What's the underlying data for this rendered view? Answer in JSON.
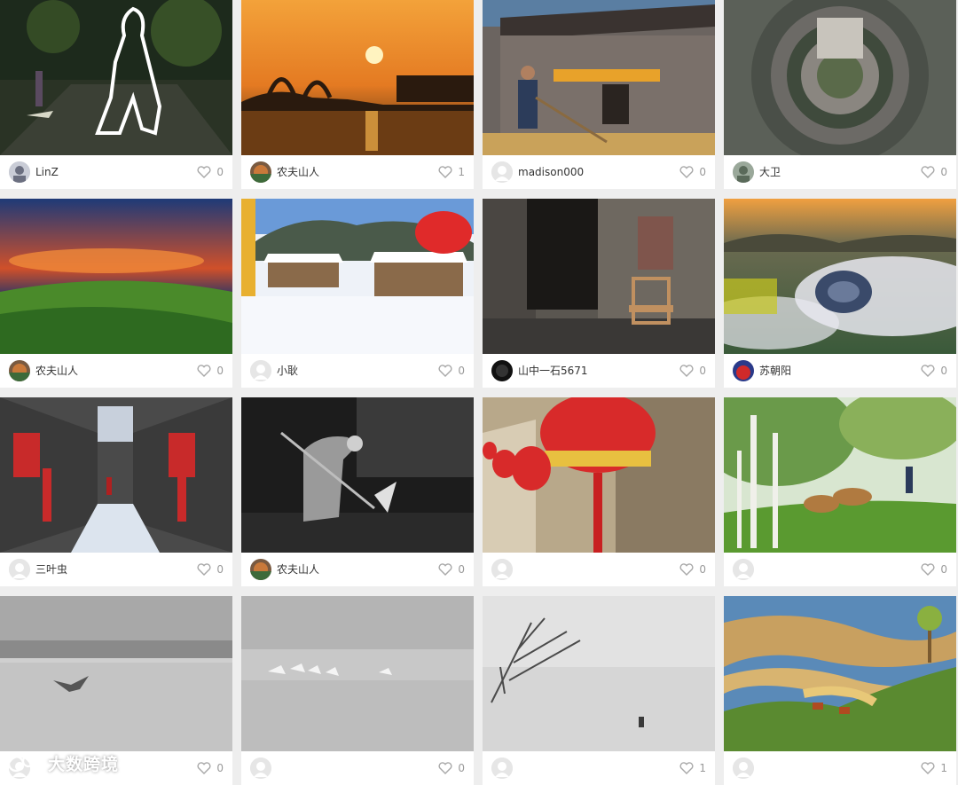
{
  "cards": [
    {
      "user": "LinZ",
      "likes": "0",
      "avatar": "photo"
    },
    {
      "user": "农夫山人",
      "likes": "1",
      "avatar": "photo"
    },
    {
      "user": "madison000",
      "likes": "0",
      "avatar": "empty"
    },
    {
      "user": "大卫",
      "likes": "0",
      "avatar": "photo"
    },
    {
      "user": "农夫山人",
      "likes": "0",
      "avatar": "photo"
    },
    {
      "user": "小耿",
      "likes": "0",
      "avatar": "empty"
    },
    {
      "user": "山中一石5671",
      "likes": "0",
      "avatar": "photo"
    },
    {
      "user": "苏朝阳",
      "likes": "0",
      "avatar": "photo"
    },
    {
      "user": "三叶虫",
      "likes": "0",
      "avatar": "empty"
    },
    {
      "user": "农夫山人",
      "likes": "0",
      "avatar": "photo"
    },
    {
      "user": "",
      "likes": "0",
      "avatar": "empty"
    },
    {
      "user": "",
      "likes": "0",
      "avatar": "empty"
    },
    {
      "user": "",
      "likes": "0",
      "avatar": "empty"
    },
    {
      "user": "",
      "likes": "0",
      "avatar": "empty"
    },
    {
      "user": "",
      "likes": "1",
      "avatar": "empty"
    },
    {
      "user": "",
      "likes": "1",
      "avatar": "empty"
    }
  ],
  "watermark": "大数跨境",
  "colors": {
    "page_bg": "#eeeeee",
    "card_bg": "#ffffff",
    "like_gray": "#9a9a9a",
    "text": "#333333"
  }
}
